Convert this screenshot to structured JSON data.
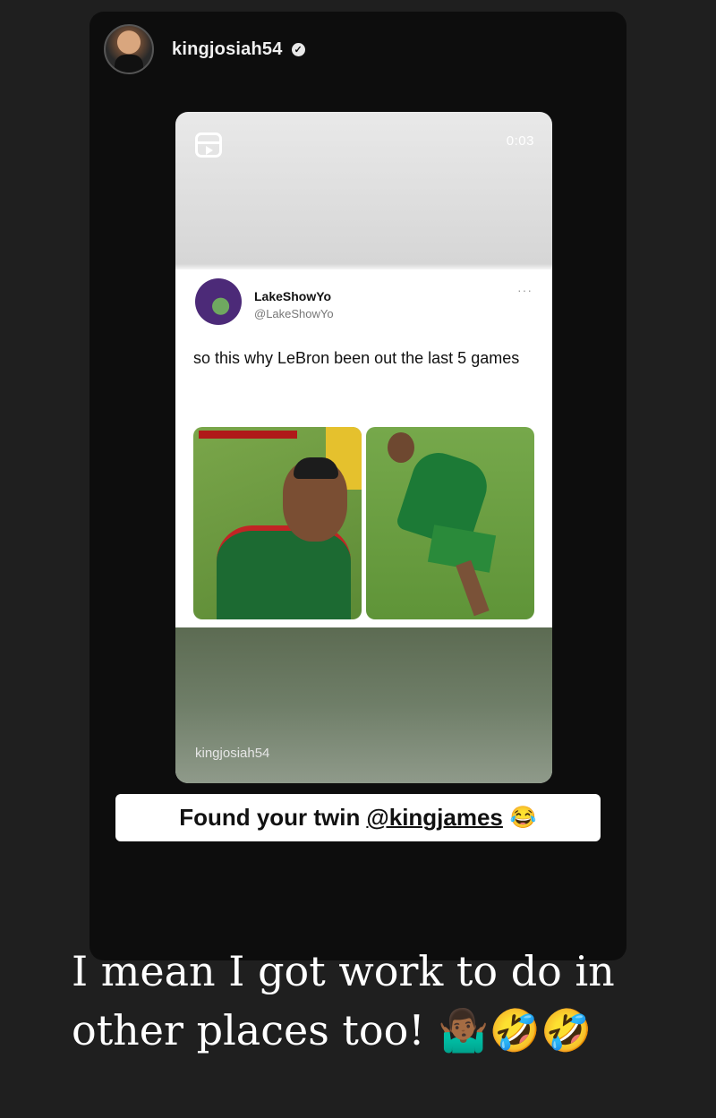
{
  "story": {
    "username": "kingjosiah54",
    "verified_icon": "verified-badge-icon"
  },
  "reel": {
    "icon": "reels-icon",
    "duration": "0:03",
    "owner": "kingjosiah54"
  },
  "tweet": {
    "display_name": "LakeShowYo",
    "handle": "@LakeShowYo",
    "more": "···",
    "text": "so this why LeBron been out the last 5 games"
  },
  "caption": {
    "text": "Found your twin",
    "mention": "@kingjames",
    "emoji": "😂"
  },
  "overlay_text": {
    "line": "I mean I got work to do in other places too! 🤷🏾‍♂️🤣🤣"
  }
}
